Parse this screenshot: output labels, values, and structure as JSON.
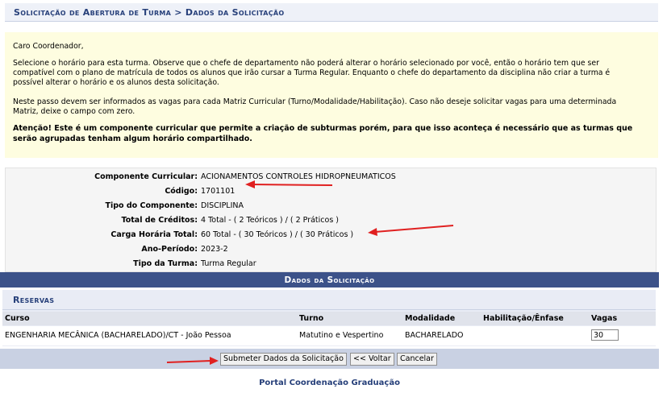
{
  "header": {
    "title": "Solicitação de Abertura de Turma > Dados da Solicitação"
  },
  "info": {
    "greeting": "Caro Coordenador,",
    "p1_line1": "Selecione o horário para esta turma. Observe que o chefe de departamento não poderá alterar o horário selecionado por você, então o horário tem que ser",
    "p1_line2": "compatível com o plano de matrícula de todos os alunos que irão cursar a Turma Regular. Enquanto o chefe do departamento da disciplina não criar a turma é",
    "p1_line3": "possível alterar o horário e os alunos desta solicitação.",
    "p2_line1": "Neste passo devem ser informados as vagas para cada Matriz Curricular (Turno/Modalidade/Habilitação). Caso não deseje solicitar vagas para uma determinada",
    "p2_line2": "Matriz, deixe o campo com zero.",
    "warn_line1": "Atenção! Este é um componente curricular que permite a criação de subturmas porém, para que isso aconteça é necessário que as turmas que",
    "warn_line2": "serão agrupadas tenham algum horário compartilhado."
  },
  "details": [
    {
      "label": "Componente Curricular:",
      "value": "ACIONAMENTOS CONTROLES HIDROPNEUMATICOS"
    },
    {
      "label": "Código:",
      "value": "1701101"
    },
    {
      "label": "Tipo do Componente:",
      "value": "DISCIPLINA"
    },
    {
      "label": "Total de Créditos:",
      "value": "4 Total - ( 2 Teóricos ) / ( 2 Práticos )"
    },
    {
      "label": "Carga Horária Total:",
      "value": "60 Total - ( 30 Teóricos ) / ( 30 Práticos )"
    },
    {
      "label": "Ano-Período:",
      "value": "2023-2"
    },
    {
      "label": "Tipo da Turma:",
      "value": "Turma Regular"
    }
  ],
  "section": {
    "title": "Dados da Solicitação"
  },
  "reservas": {
    "title": "Reservas",
    "columns": [
      "Curso",
      "Turno",
      "Modalidade",
      "Habilitação/Ênfase",
      "Vagas"
    ],
    "rows": [
      {
        "curso": "ENGENHARIA MECÂNICA (BACHARELADO)/CT - João Pessoa",
        "turno": "Matutino e Vespertino",
        "modalidade": "BACHARELADO",
        "habilitacao": "",
        "vagas": "30"
      }
    ]
  },
  "buttons": {
    "submit": "Submeter Dados da Solicitação",
    "back": "<< Voltar",
    "cancel": "Cancelar"
  },
  "footer": {
    "text": "Portal Coordenação Graduação"
  },
  "colors": {
    "accent": "#3c5289",
    "info_bg": "#fefde0",
    "arrow": "#e02020"
  }
}
